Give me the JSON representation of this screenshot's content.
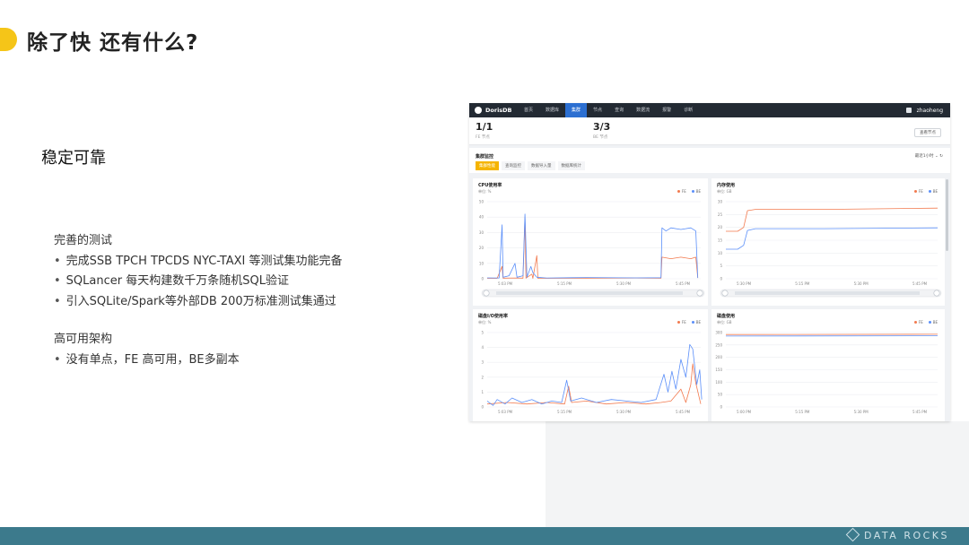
{
  "slide": {
    "title": "除了快 还有什么?",
    "section_title": "稳定可靠",
    "group1_heading": "完善的测试",
    "group1_items": [
      "完成SSB  TPCH TPCDS NYC-TAXI 等测试集功能完备",
      "SQLancer 每天构建数千万条随机SQL验证",
      "引入SQLite/Spark等外部DB 200万标准测试集通过"
    ],
    "group2_heading": "高可用架构",
    "group2_items": [
      "没有单点，FE 高可用，BE多副本"
    ],
    "brand": "DATA ROCKS",
    "colors": {
      "accent": "#f5c518",
      "footer": "#3c7a8c"
    }
  },
  "app": {
    "logo_text": "DorisDB",
    "nav": [
      "首页",
      "数据库",
      "集群",
      "节点",
      "查询",
      "数据流",
      "报警",
      "诊断"
    ],
    "active_nav": 2,
    "user": "zhaoheng",
    "stats": [
      {
        "value": "1/1",
        "label": "FE 节点"
      },
      {
        "value": "3/3",
        "label": "BE 节点"
      }
    ],
    "view_nodes_button": "查看节点",
    "monitor_title": "集群监控",
    "time_range": "最近1小时",
    "monitor_tabs": [
      "集群性能",
      "查询监控",
      "数据导入量",
      "数据库统计"
    ],
    "active_monitor_tab": 0,
    "legend": {
      "fe": "FE",
      "be": "BE"
    },
    "colors": {
      "fe": "#f27a4f",
      "be": "#5b8ff9",
      "active_nav": "#2c6fd1",
      "active_tab": "#f5b400"
    }
  },
  "chart_data": [
    {
      "type": "line",
      "title": "CPU使用率",
      "unit": "单位: %",
      "yticks": [
        0,
        10,
        20,
        30,
        40,
        50
      ],
      "ylim": [
        0,
        50
      ],
      "xticks": [
        "5:03 PM",
        "5:15 PM",
        "5:30 PM",
        "5:45 PM"
      ],
      "series": [
        {
          "name": "FE",
          "values": [
            [
              0,
              0.3
            ],
            [
              10,
              0.3
            ],
            [
              15,
              8
            ],
            [
              16,
              0.4
            ],
            [
              30,
              0.5
            ],
            [
              36,
              0.4
            ],
            [
              38,
              40
            ],
            [
              39,
              0.4
            ],
            [
              45,
              3
            ],
            [
              46,
              0.3
            ],
            [
              50,
              15
            ],
            [
              51,
              0.3
            ],
            [
              100,
              0.4
            ],
            [
              150,
              0.5
            ],
            [
              175,
              0.4
            ],
            [
              176,
              14
            ],
            [
              185,
              13
            ],
            [
              195,
              14
            ],
            [
              205,
              13
            ],
            [
              210,
              14
            ],
            [
              212,
              0.5
            ]
          ]
        },
        {
          "name": "BE",
          "values": [
            [
              0,
              0.6
            ],
            [
              12,
              0.5
            ],
            [
              15,
              35
            ],
            [
              16,
              1
            ],
            [
              22,
              2
            ],
            [
              28,
              10
            ],
            [
              30,
              1
            ],
            [
              36,
              2
            ],
            [
              38,
              42
            ],
            [
              40,
              1
            ],
            [
              44,
              8
            ],
            [
              46,
              4
            ],
            [
              50,
              1
            ],
            [
              60,
              0.5
            ],
            [
              100,
              0.8
            ],
            [
              150,
              0.6
            ],
            [
              175,
              0.7
            ],
            [
              176,
              33
            ],
            [
              180,
              31
            ],
            [
              185,
              33
            ],
            [
              195,
              32
            ],
            [
              205,
              33
            ],
            [
              210,
              31
            ],
            [
              212,
              0.5
            ]
          ]
        }
      ]
    },
    {
      "type": "line",
      "title": "内存使用",
      "unit": "单位: GB",
      "yticks": [
        0,
        5,
        10,
        15,
        20,
        25,
        30
      ],
      "ylim": [
        0,
        30
      ],
      "xticks": [
        "5:30 PM",
        "5:15 PM",
        "5:30 PM",
        "5:45 PM"
      ],
      "series": [
        {
          "name": "FE",
          "values": [
            [
              0,
              18.5
            ],
            [
              12,
              18.5
            ],
            [
              18,
              20
            ],
            [
              22,
              26.5
            ],
            [
              30,
              27
            ],
            [
              100,
              27
            ],
            [
              215,
              27.5
            ]
          ]
        },
        {
          "name": "BE",
          "values": [
            [
              0,
              11.5
            ],
            [
              12,
              11.5
            ],
            [
              18,
              13
            ],
            [
              22,
              18.8
            ],
            [
              30,
              19.5
            ],
            [
              100,
              19.5
            ],
            [
              215,
              19.8
            ]
          ]
        }
      ]
    },
    {
      "type": "line",
      "title": "磁盘I/O使用率",
      "unit": "单位: %",
      "yticks": [
        0,
        1,
        2,
        3,
        4,
        5
      ],
      "ylim": [
        0,
        5
      ],
      "xticks": [
        "5:03 PM",
        "5:15 PM",
        "5:30 PM",
        "5:45 PM"
      ],
      "series": [
        {
          "name": "FE",
          "values": [
            [
              0,
              0.2
            ],
            [
              20,
              0.3
            ],
            [
              40,
              0.2
            ],
            [
              60,
              0.3
            ],
            [
              78,
              0.2
            ],
            [
              82,
              1.4
            ],
            [
              85,
              0.3
            ],
            [
              100,
              0.4
            ],
            [
              120,
              0.2
            ],
            [
              140,
              0.3
            ],
            [
              160,
              0.2
            ],
            [
              175,
              0.3
            ],
            [
              185,
              0.4
            ],
            [
              195,
              1.2
            ],
            [
              200,
              0.3
            ],
            [
              205,
              1.5
            ],
            [
              207,
              2.9
            ],
            [
              210,
              1.6
            ],
            [
              215,
              0.2
            ]
          ]
        },
        {
          "name": "BE",
          "values": [
            [
              0,
              0.4
            ],
            [
              6,
              0.1
            ],
            [
              10,
              0.5
            ],
            [
              18,
              0.2
            ],
            [
              25,
              0.6
            ],
            [
              35,
              0.3
            ],
            [
              45,
              0.5
            ],
            [
              55,
              0.2
            ],
            [
              65,
              0.4
            ],
            [
              75,
              0.3
            ],
            [
              80,
              1.8
            ],
            [
              84,
              0.4
            ],
            [
              95,
              0.6
            ],
            [
              110,
              0.3
            ],
            [
              125,
              0.5
            ],
            [
              140,
              0.4
            ],
            [
              155,
              0.3
            ],
            [
              170,
              0.5
            ],
            [
              178,
              2.2
            ],
            [
              182,
              1.0
            ],
            [
              186,
              2.4
            ],
            [
              190,
              1.2
            ],
            [
              195,
              3.2
            ],
            [
              200,
              2.0
            ],
            [
              204,
              4.2
            ],
            [
              207,
              3.9
            ],
            [
              211,
              1.5
            ],
            [
              214,
              2.5
            ],
            [
              216,
              0.5
            ]
          ]
        }
      ]
    },
    {
      "type": "line",
      "title": "磁盘使用",
      "unit": "单位: GB",
      "yticks": [
        0,
        50,
        100,
        150,
        200,
        250,
        300
      ],
      "ylim": [
        0,
        300
      ],
      "xticks": [
        "5:00 PM",
        "5:15 PM",
        "5:30 PM",
        "5:45 PM"
      ],
      "series": [
        {
          "name": "FE",
          "values": [
            [
              0,
              292
            ],
            [
              215,
              293
            ]
          ]
        },
        {
          "name": "BE",
          "values": [
            [
              0,
              286
            ],
            [
              215,
              287
            ]
          ]
        }
      ]
    }
  ]
}
